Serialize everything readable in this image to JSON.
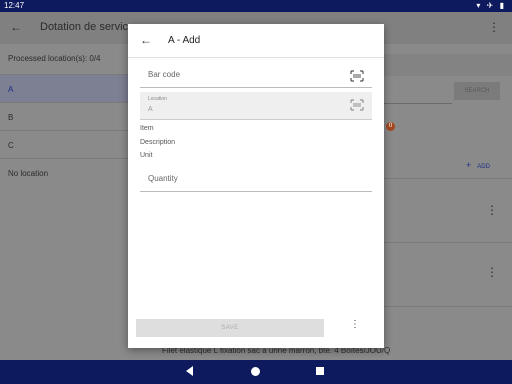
{
  "status_bar": {
    "time": "12:47",
    "icons": [
      "wifi-icon",
      "airplane-icon",
      "battery-icon"
    ]
  },
  "background": {
    "toolbar": {
      "title": "Dotation de service"
    },
    "processed": "Processed location(s): 0/4",
    "locations": [
      "A",
      "B",
      "C",
      "No location"
    ],
    "search_button": "SEARCH",
    "badge": "0",
    "add_label": "ADD",
    "bottom_text": "Filet élastique L fixation sac à urine marron, bte. 4 Boîtes/JOU/Q"
  },
  "dialog": {
    "title": "A - Add",
    "barcode_placeholder": "Bar code",
    "location_label": "Location",
    "location_value": "A",
    "info": {
      "item": "Item",
      "description": "Description",
      "unit": "Unit"
    },
    "quantity_placeholder": "Quantity",
    "save_label": "SAVE"
  },
  "colors": {
    "status_bar": "#0d1a5e",
    "accent": "#1d2d86",
    "badge": "#a44820"
  }
}
